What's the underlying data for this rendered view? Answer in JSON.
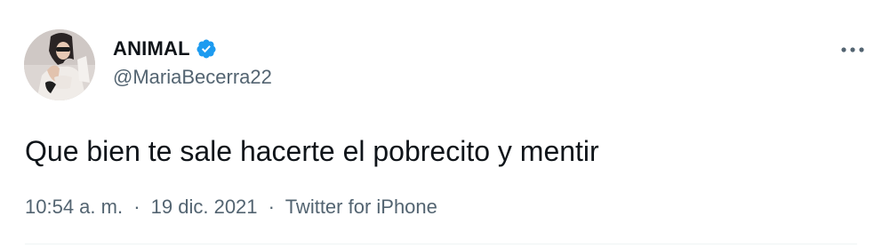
{
  "author": {
    "display_name": "ANIMAL",
    "handle": "@MariaBecerra22",
    "verified": true,
    "avatar_icon": "profile-photo"
  },
  "tweet": {
    "text": "Que bien te sale hacerte el pobrecito y mentir",
    "time": "10:54 a. m.",
    "date": "19 dic. 2021",
    "source": "Twitter for iPhone",
    "separator": "·"
  },
  "icons": {
    "verified_badge": "verified-badge-icon",
    "more": "more-options-icon"
  },
  "colors": {
    "verified_blue": "#1d9bf0",
    "secondary_text": "#536471",
    "primary_text": "#0f1419"
  }
}
